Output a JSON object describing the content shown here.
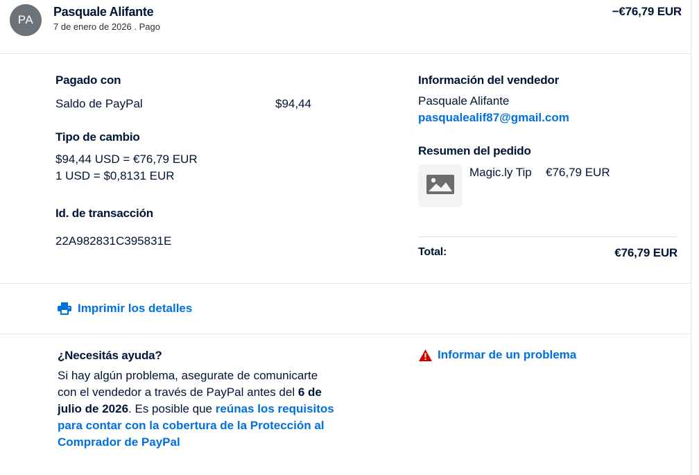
{
  "header": {
    "avatar_initials": "PA",
    "name": "Pasquale Alifante",
    "date_line": "7 de enero de 2026 . Pago",
    "amount": "−€76,79 EUR"
  },
  "payment": {
    "paid_with_title": "Pagado con",
    "method": "Saldo de PayPal",
    "method_amount": "$94,44",
    "exchange_title": "Tipo de cambio",
    "exchange_line1": "$94,44 USD = €76,79 EUR",
    "exchange_line2": "1 USD = $0,8131 EUR",
    "txn_title": "Id. de transacción",
    "txn_id": "22A982831C395831E"
  },
  "seller": {
    "title": "Información del vendedor",
    "name": "Pasquale Alifante",
    "email": "pasqualealif87@gmail.com"
  },
  "order": {
    "title": "Resumen del pedido",
    "item_name": "Magic.ly Tip",
    "item_amount": "€76,79 EUR",
    "total_label": "Total:",
    "total_value": "€76,79 EUR"
  },
  "actions": {
    "print_label": "Imprimir los detalles",
    "report_label": "Informar de un problema"
  },
  "help": {
    "title": "¿Necesitás ayuda?",
    "text_before": "Si hay algún problema, asegurate de comunicarte con el vendedor a través de PayPal antes del ",
    "deadline": "6 de julio de 2026",
    "text_middle": ". Es posible que ",
    "link_text": "reúnas los requisitos para contar con la cobertura de la Protección al Comprador de PayPal"
  },
  "colors": {
    "link": "#0070e0",
    "text": "#001435",
    "avatar_bg": "#6c7378",
    "warning": "#d20000"
  },
  "icons": [
    "printer-icon",
    "warning-icon",
    "image-placeholder-icon"
  ]
}
